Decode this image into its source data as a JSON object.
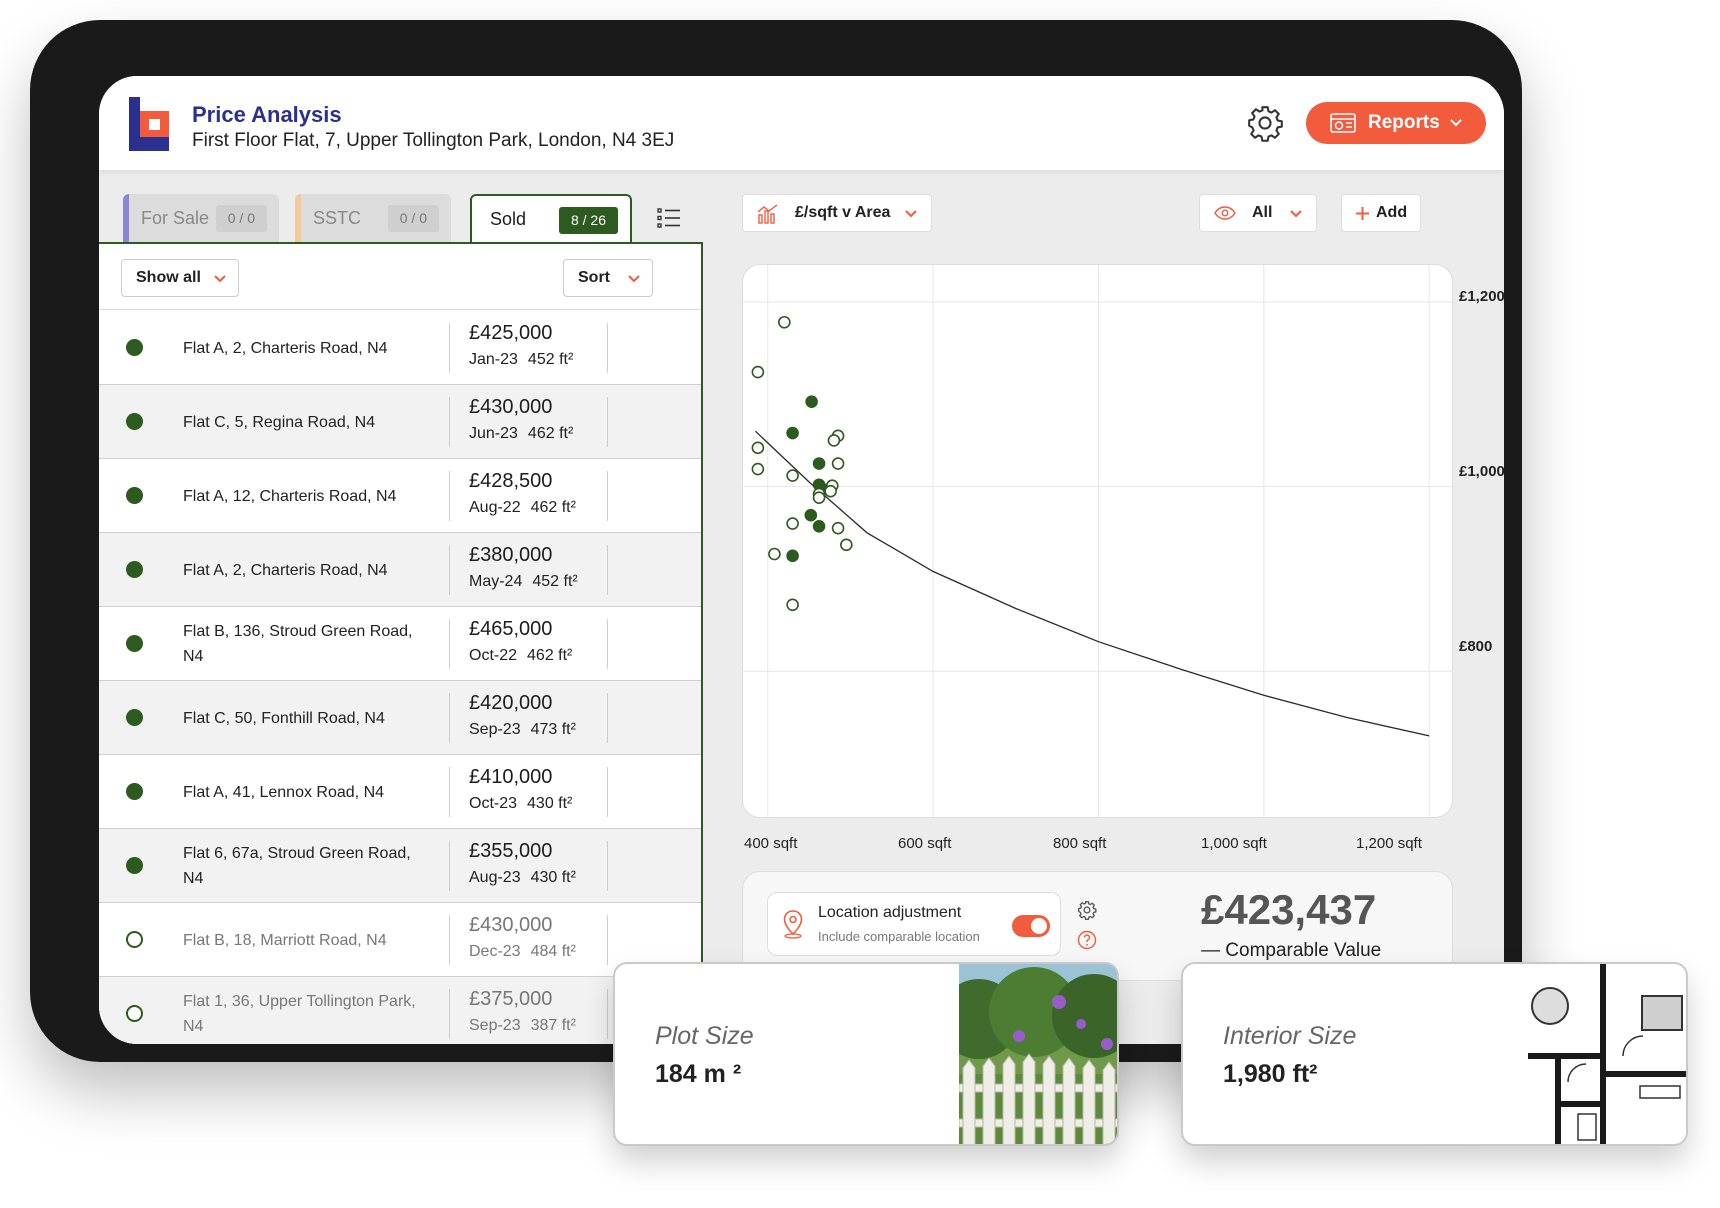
{
  "header": {
    "title": "Price Analysis",
    "address": "First Floor Flat, 7, Upper Tollington Park, London, N4 3EJ",
    "reports_label": "Reports"
  },
  "tabs": [
    {
      "label": "For Sale",
      "count": "0 / 0",
      "color": "#8a86d4"
    },
    {
      "label": "SSTC",
      "count": "0 / 0",
      "color": "#f5c89a"
    },
    {
      "label": "Sold",
      "count": "8 / 26",
      "color": "#2d5a1e"
    }
  ],
  "filters": {
    "show_all": "Show all",
    "sort": "Sort"
  },
  "listings": [
    {
      "address": "Flat A, 2, Charteris Road, N4",
      "price": "£425,000",
      "date": "Jan-23",
      "size": "452 ft²",
      "selected": true
    },
    {
      "address": "Flat C, 5, Regina Road, N4",
      "price": "£430,000",
      "date": "Jun-23",
      "size": "462 ft²",
      "selected": true
    },
    {
      "address": "Flat A, 12, Charteris Road, N4",
      "price": "£428,500",
      "date": "Aug-22",
      "size": "462 ft²",
      "selected": true
    },
    {
      "address": "Flat A, 2, Charteris Road, N4",
      "price": "£380,000",
      "date": "May-24",
      "size": "452 ft²",
      "selected": true
    },
    {
      "address": "Flat B, 136, Stroud Green Road, N4",
      "price": "£465,000",
      "date": "Oct-22",
      "size": "462 ft²",
      "selected": true
    },
    {
      "address": "Flat C, 50, Fonthill Road, N4",
      "price": "£420,000",
      "date": "Sep-23",
      "size": "473 ft²",
      "selected": true
    },
    {
      "address": "Flat A, 41, Lennox Road, N4",
      "price": "£410,000",
      "date": "Oct-23",
      "size": "430 ft²",
      "selected": true
    },
    {
      "address": "Flat 6, 67a, Stroud Green Road, N4",
      "price": "£355,000",
      "date": "Aug-23",
      "size": "430 ft²",
      "selected": true
    },
    {
      "address": "Flat B, 18, Marriott Road, N4",
      "price": "£430,000",
      "date": "Dec-23",
      "size": "484 ft²",
      "selected": false
    },
    {
      "address": "Flat 1, 36, Upper Tollington Park, N4",
      "price": "£375,000",
      "date": "Sep-23",
      "size": "387 ft²",
      "selected": false
    }
  ],
  "chart_toolbar": {
    "chart_type": "£/sqft v Area",
    "visibility": "All",
    "add_label": "Add"
  },
  "chart_data": {
    "type": "scatter",
    "xlabel": "",
    "ylabel": "",
    "x_ticks": [
      "400 sqft",
      "600 sqft",
      "800 sqft",
      "1,000 sqft",
      "1,200 sqft"
    ],
    "y_ticks": [
      "£1,200",
      "£1,000",
      "£800"
    ],
    "xlim": [
      370,
      1230
    ],
    "ylim": [
      640,
      1240
    ],
    "grid": true,
    "series": [
      {
        "filled": true,
        "points": [
          [
            453,
            1092
          ],
          [
            430,
            1058
          ],
          [
            462,
            1025
          ],
          [
            462,
            1002
          ],
          [
            473,
            997
          ],
          [
            452,
            969
          ],
          [
            462,
            957
          ],
          [
            430,
            925
          ]
        ]
      },
      {
        "filled": false,
        "points": [
          [
            420,
            1178
          ],
          [
            388,
            1124
          ],
          [
            485,
            1055
          ],
          [
            480,
            1050
          ],
          [
            388,
            1042
          ],
          [
            485,
            1025
          ],
          [
            388,
            1019
          ],
          [
            430,
            1012
          ],
          [
            462,
            992
          ],
          [
            478,
            1001
          ],
          [
            476,
            995
          ],
          [
            462,
            988
          ],
          [
            430,
            960
          ],
          [
            485,
            955
          ],
          [
            495,
            937
          ],
          [
            408,
            927
          ],
          [
            430,
            872
          ]
        ]
      }
    ],
    "trend": [
      [
        385,
        1060
      ],
      [
        450,
        1005
      ],
      [
        520,
        950
      ],
      [
        600,
        908
      ],
      [
        700,
        868
      ],
      [
        800,
        832
      ],
      [
        900,
        802
      ],
      [
        1000,
        774
      ],
      [
        1100,
        750
      ],
      [
        1200,
        730
      ]
    ]
  },
  "location": {
    "title": "Location adjustment",
    "subtitle": "Include comparable location",
    "enabled": true
  },
  "valuation": {
    "value": "£423,437",
    "label": "— Comparable Value"
  },
  "plot_card": {
    "title": "Plot Size",
    "value": "184 m ²"
  },
  "interior_card": {
    "title": "Interior Size",
    "value": "1,980 ft²"
  },
  "colors": {
    "brand_blue": "#2b2f8f",
    "accent_orange": "#f25c3c",
    "sold_green": "#2d5a1e"
  }
}
